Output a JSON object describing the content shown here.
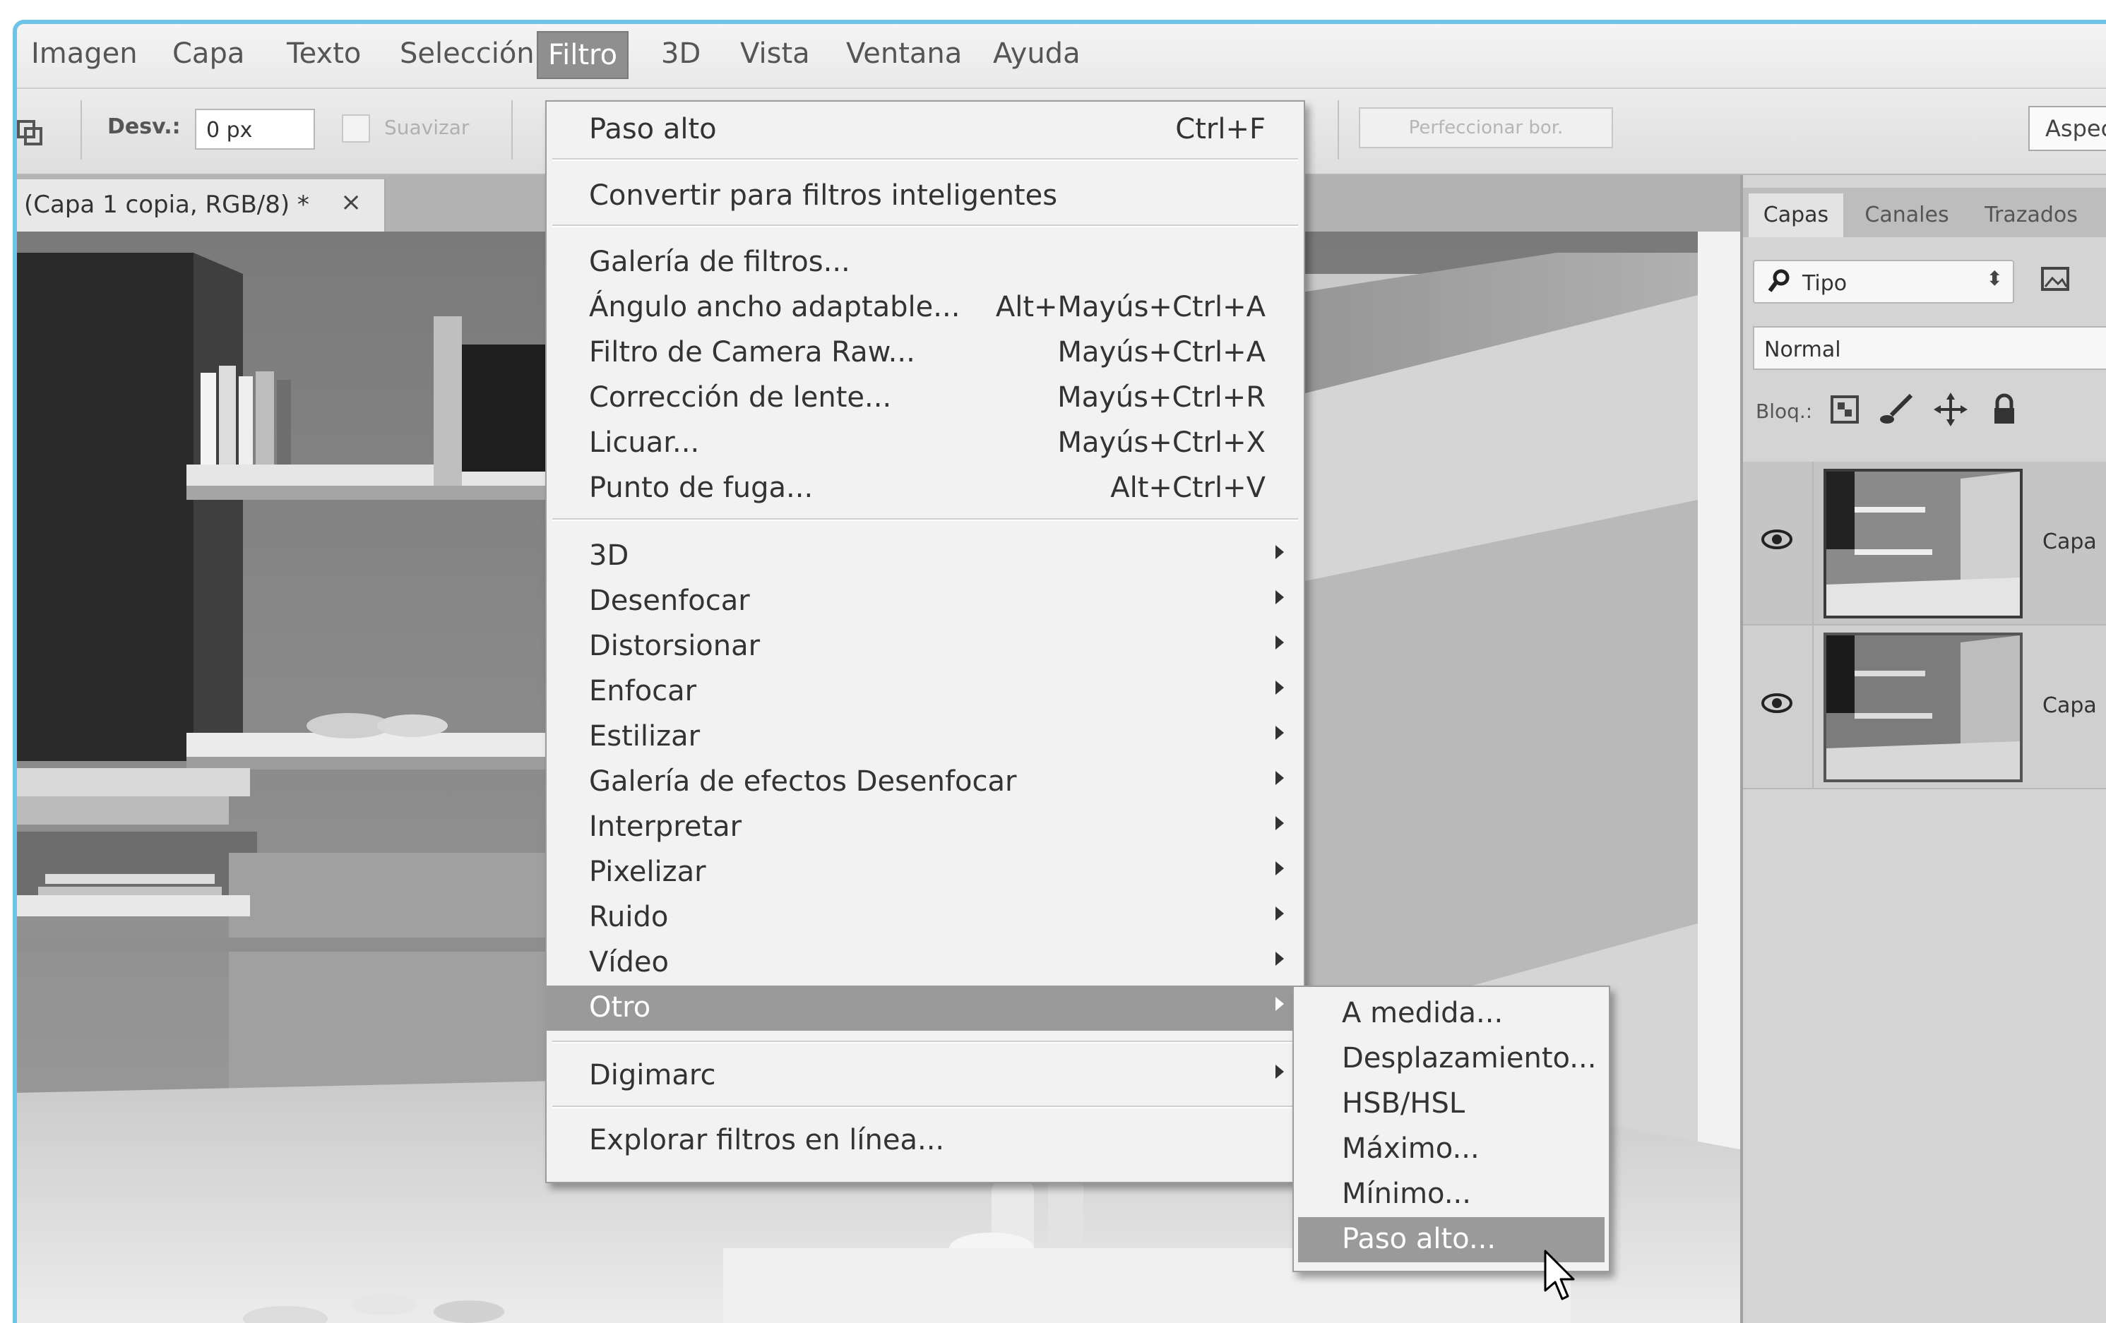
{
  "menubar": {
    "items": [
      "Imagen",
      "Capa",
      "Texto",
      "Selección",
      "Filtro",
      "3D",
      "Vista",
      "Ventana",
      "Ayuda"
    ],
    "active": "Filtro"
  },
  "options": {
    "desv_label": "Desv.:",
    "desv_value": "0 px",
    "suavizar_label": "Suavizar",
    "perfeccionar_label": "Perfeccionar bor.",
    "aspecto_label": "Aspec"
  },
  "document": {
    "tab_title": "(Capa 1 copia, RGB/8) *",
    "close_glyph": "×"
  },
  "panel": {
    "tabs": [
      "Capas",
      "Canales",
      "Trazados"
    ],
    "filter_icon": "search-icon",
    "filter_label": "Tipo",
    "blend_mode": "Normal",
    "lock_label": "Bloq.:",
    "layers": [
      {
        "name": "Capa",
        "visible": true,
        "selected": true
      },
      {
        "name": "Capa",
        "visible": true,
        "selected": false
      }
    ]
  },
  "filter_menu": {
    "last_filter": {
      "label": "Paso alto",
      "shortcut": "Ctrl+F"
    },
    "smart_filters": "Convertir para filtros inteligentes",
    "items": [
      {
        "label": "Galería de filtros...",
        "shortcut": ""
      },
      {
        "label": "Ángulo ancho adaptable...",
        "shortcut": "Alt+Mayús+Ctrl+A"
      },
      {
        "label": "Filtro de Camera Raw...",
        "shortcut": "Mayús+Ctrl+A"
      },
      {
        "label": "Corrección de lente...",
        "shortcut": "Mayús+Ctrl+R"
      },
      {
        "label": "Licuar...",
        "shortcut": "Mayús+Ctrl+X"
      },
      {
        "label": "Punto de fuga...",
        "shortcut": "Alt+Ctrl+V"
      }
    ],
    "submenus": [
      "3D",
      "Desenfocar",
      "Distorsionar",
      "Enfocar",
      "Estilizar",
      "Galería de efectos Desenfocar",
      "Interpretar",
      "Pixelizar",
      "Ruido",
      "Vídeo",
      "Otro"
    ],
    "highlighted": "Otro",
    "digimarc": "Digimarc",
    "browse_online": "Explorar filtros en línea..."
  },
  "otro_submenu": {
    "items": [
      "A medida...",
      "Desplazamiento...",
      "HSB/HSL",
      "Máximo...",
      "Mínimo...",
      "Paso alto..."
    ],
    "highlighted": "Paso alto..."
  },
  "colors": {
    "frame_border": "#6fc3e6",
    "menu_highlight": "#9a9a9a"
  }
}
